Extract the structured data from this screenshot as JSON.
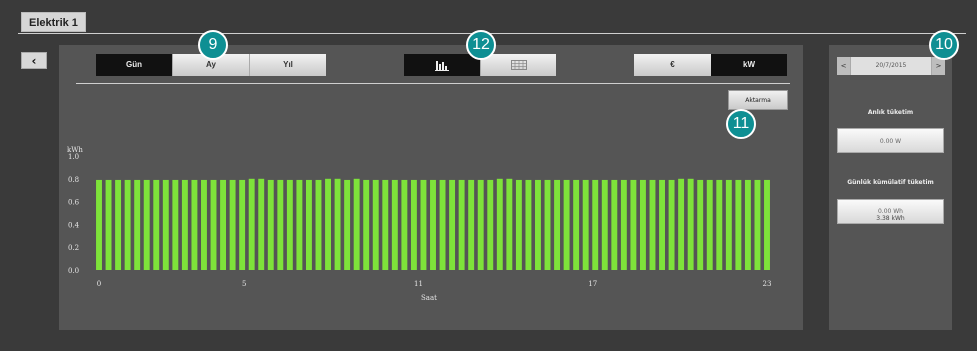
{
  "window": {
    "title": "Elektrik 1"
  },
  "period_tabs": [
    "Gün",
    "Ay",
    "Yıl"
  ],
  "unit_tabs": [
    "€",
    "kW"
  ],
  "export_label": "Aktarma",
  "badges": [
    "9",
    "12",
    "10",
    "11"
  ],
  "date_nav": {
    "prev": "<",
    "date": "20/7/2015",
    "next": ">"
  },
  "instant": {
    "label": "Anlık tüketim",
    "value": "0.00 W"
  },
  "cumulative": {
    "label": "Günlük kümülatif tüketim",
    "value": "0.00 Wh",
    "sub_value": "3.38 kWh"
  },
  "colors": {
    "bar": "#7ee33a",
    "badge": "#0e8f93",
    "panel": "#555555",
    "background": "#3a3a3a"
  },
  "icons": {
    "back": "chevron-left-icon",
    "bar_view": "bar-chart-icon",
    "table_view": "table-grid-icon"
  },
  "chart_data": {
    "type": "bar",
    "title": "",
    "ylabel": "kWh",
    "xlabel": "Saat",
    "ylim": [
      0,
      1.0
    ],
    "yticks": [
      "0.0",
      "0.2",
      "0.4",
      "0.6",
      "0.8",
      "1.0"
    ],
    "xticks": [
      {
        "x": 0,
        "label": "0"
      },
      {
        "x": 5,
        "label": "5"
      },
      {
        "x": 11,
        "label": "11"
      },
      {
        "x": 17,
        "label": "17"
      },
      {
        "x": 23,
        "label": "23"
      }
    ],
    "x_range": [
      0,
      23
    ],
    "values": [
      0.79,
      0.79,
      0.79,
      0.79,
      0.79,
      0.79,
      0.79,
      0.79,
      0.79,
      0.79,
      0.79,
      0.79,
      0.79,
      0.79,
      0.79,
      0.79,
      0.8,
      0.8,
      0.79,
      0.79,
      0.79,
      0.79,
      0.79,
      0.79,
      0.8,
      0.8,
      0.79,
      0.8,
      0.79,
      0.79,
      0.79,
      0.79,
      0.79,
      0.79,
      0.79,
      0.79,
      0.79,
      0.79,
      0.79,
      0.79,
      0.79,
      0.79,
      0.8,
      0.8,
      0.79,
      0.79,
      0.79,
      0.79,
      0.79,
      0.79,
      0.79,
      0.79,
      0.79,
      0.79,
      0.79,
      0.79,
      0.79,
      0.79,
      0.79,
      0.79,
      0.79,
      0.8,
      0.8,
      0.79,
      0.79,
      0.79,
      0.79,
      0.79,
      0.79,
      0.79,
      0.79
    ]
  }
}
